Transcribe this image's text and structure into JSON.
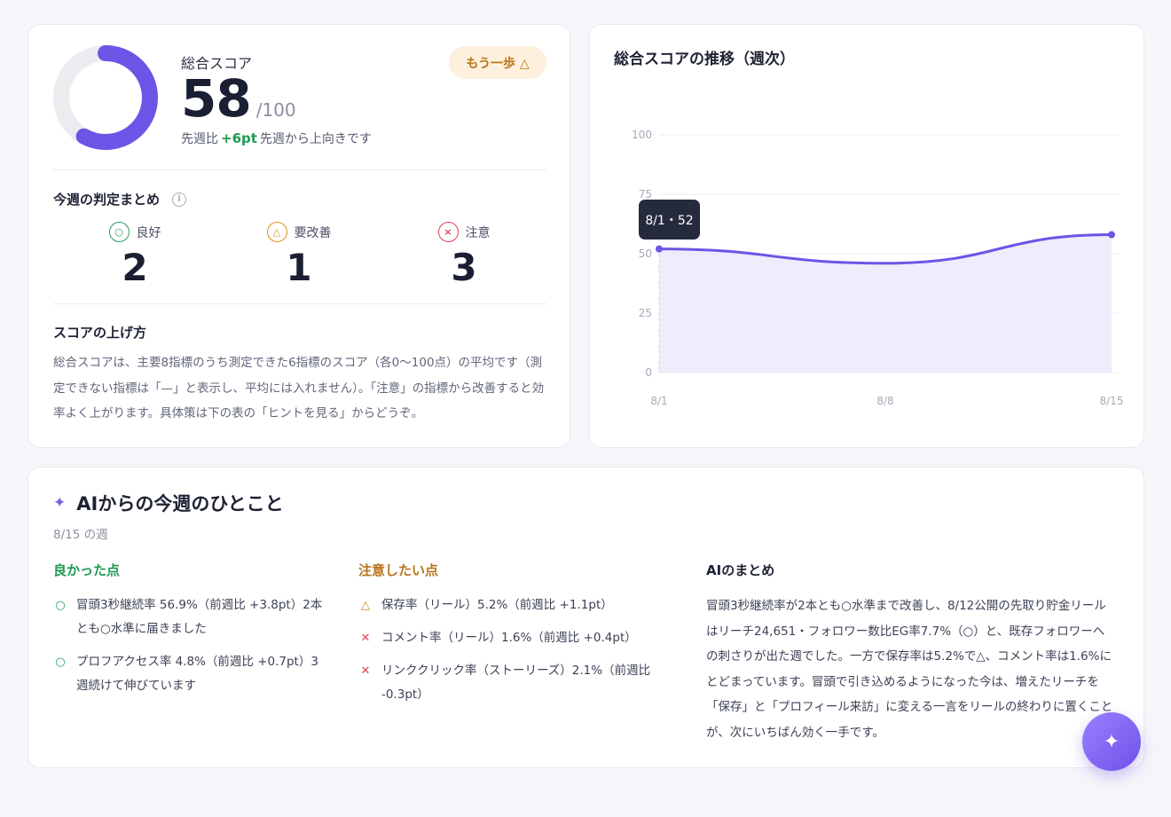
{
  "score": {
    "label": "総合スコア",
    "value": "58",
    "max": "/100",
    "value_fraction": 0.58,
    "delta_prefix": "先週比",
    "delta": "+6pt",
    "delta_suffix": "先週から上向きです",
    "status_badge": "もう一歩 △",
    "colors": {
      "gauge": "#6c55e6",
      "gauge_track": "#ececf0",
      "delta": "#1e9a52",
      "badge_bg": "#fdf0dc",
      "badge_text": "#b9741a"
    }
  },
  "judgement": {
    "title": "今週の判定まとめ",
    "info_icon": "info-icon",
    "items": [
      {
        "icon": "circle-icon",
        "symbol": "○",
        "label": "良好",
        "count": "2"
      },
      {
        "icon": "triangle-icon",
        "symbol": "△",
        "label": "要改善",
        "count": "1"
      },
      {
        "icon": "cross-icon",
        "symbol": "×",
        "label": "注意",
        "count": "3"
      }
    ]
  },
  "tips": {
    "title": "スコアの上げ方",
    "body": "総合スコアは、主要8指標のうち測定できた6指標のスコア（各0〜100点）の平均です（測定できない指標は「—」と表示し、平均には入れません）。「注意」の指標から改善すると効率よく上がります。具体策は下の表の「ヒントを見る」からどうぞ。"
  },
  "trend": {
    "title": "総合スコアの推移（週次）",
    "tooltip": "8/1・52"
  },
  "chart_data": {
    "type": "area",
    "title": "総合スコアの推移（週次）",
    "categories": [
      "8/1",
      "8/8",
      "8/15"
    ],
    "series": [
      {
        "values": [
          52,
          46,
          58
        ]
      }
    ],
    "ylim": [
      0,
      100
    ],
    "yticks": [
      "0",
      "25",
      "50",
      "75",
      "100"
    ],
    "grid": true,
    "colors": {
      "line": "#6c55e6",
      "fill": "#ece9fb"
    }
  },
  "ai": {
    "icon": "sparkle-icon",
    "title": "AIからの今週のひとこと",
    "week": "8/15 の週",
    "good": {
      "title": "良かった点",
      "items": [
        {
          "icon": "circle-icon",
          "text": "冒頭3秒継続率 56.9%（前週比 +3.8pt）2本とも○水準に届きました"
        },
        {
          "icon": "circle-icon",
          "text": "プロフアクセス率 4.8%（前週比 +0.7pt）3週続けて伸びています"
        }
      ]
    },
    "caution": {
      "title": "注意したい点",
      "items": [
        {
          "icon": "triangle-icon",
          "text": "保存率（リール）5.2%（前週比 +1.1pt）"
        },
        {
          "icon": "cross-icon",
          "text": "コメント率（リール）1.6%（前週比 +0.4pt）"
        },
        {
          "icon": "cross-icon",
          "text": "リンククリック率（ストーリーズ）2.1%（前週比 -0.3pt）"
        }
      ]
    },
    "summary": {
      "title": "AIのまとめ",
      "body": "冒頭3秒継続率が2本とも○水準まで改善し、8/12公開の先取り貯金リールはリーチ24,651・フォロワー数比EG率7.7%（○）と、既存フォロワーへの刺さりが出た週でした。一方で保存率は5.2%で△、コメント率は1.6%にとどまっています。冒頭で引き込めるようになった今は、増えたリーチを「保存」と「プロフィール来訪」に変える一言をリールの終わりに置くことが、次にいちばん効く一手です。"
    }
  },
  "fab": {
    "icon": "sparkle-icon"
  }
}
